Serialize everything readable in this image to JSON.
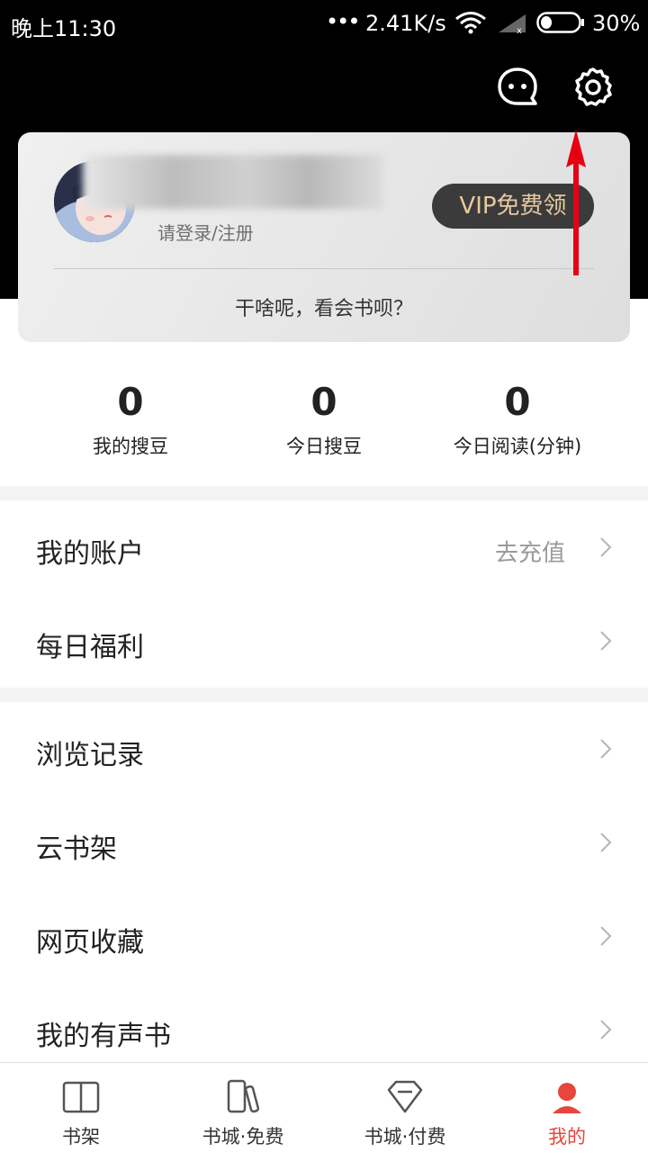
{
  "status_bar": {
    "time": "晚上11:30",
    "dots": "•••",
    "speed": "2.41K/s",
    "battery_level": 0.3,
    "battery_text": "30%"
  },
  "header": {
    "message_icon": "chat-bubble-icon",
    "settings_icon": "gear-icon"
  },
  "profile_card": {
    "login_prompt": "请登录/注册",
    "vip_label": "VIP免费领",
    "slogan": "干啥呢，看会书呗？"
  },
  "stats": [
    {
      "value": "0",
      "label": "我的搜豆"
    },
    {
      "value": "0",
      "label": "今日搜豆"
    },
    {
      "value": "0",
      "label": "今日阅读(分钟)"
    }
  ],
  "menu_group_1": [
    {
      "label": "我的账户",
      "extra": "去充值"
    },
    {
      "label": "每日福利",
      "extra": ""
    }
  ],
  "menu_group_2": [
    {
      "label": "浏览记录"
    },
    {
      "label": "云书架"
    },
    {
      "label": "网页收藏"
    },
    {
      "label": "我的有声书"
    }
  ],
  "tabs": [
    {
      "label": "书架",
      "icon": "open-book-icon",
      "active": false
    },
    {
      "label": "书城·免费",
      "icon": "books-icon",
      "active": false
    },
    {
      "label": "书城·付费",
      "icon": "diamond-icon",
      "active": false
    },
    {
      "label": "我的",
      "icon": "profile-icon",
      "active": true
    }
  ],
  "colors": {
    "accent": "#e8453c",
    "header_bg": "#000000",
    "vip_text": "#e7c9a0",
    "annotation_arrow": "#e60012"
  }
}
